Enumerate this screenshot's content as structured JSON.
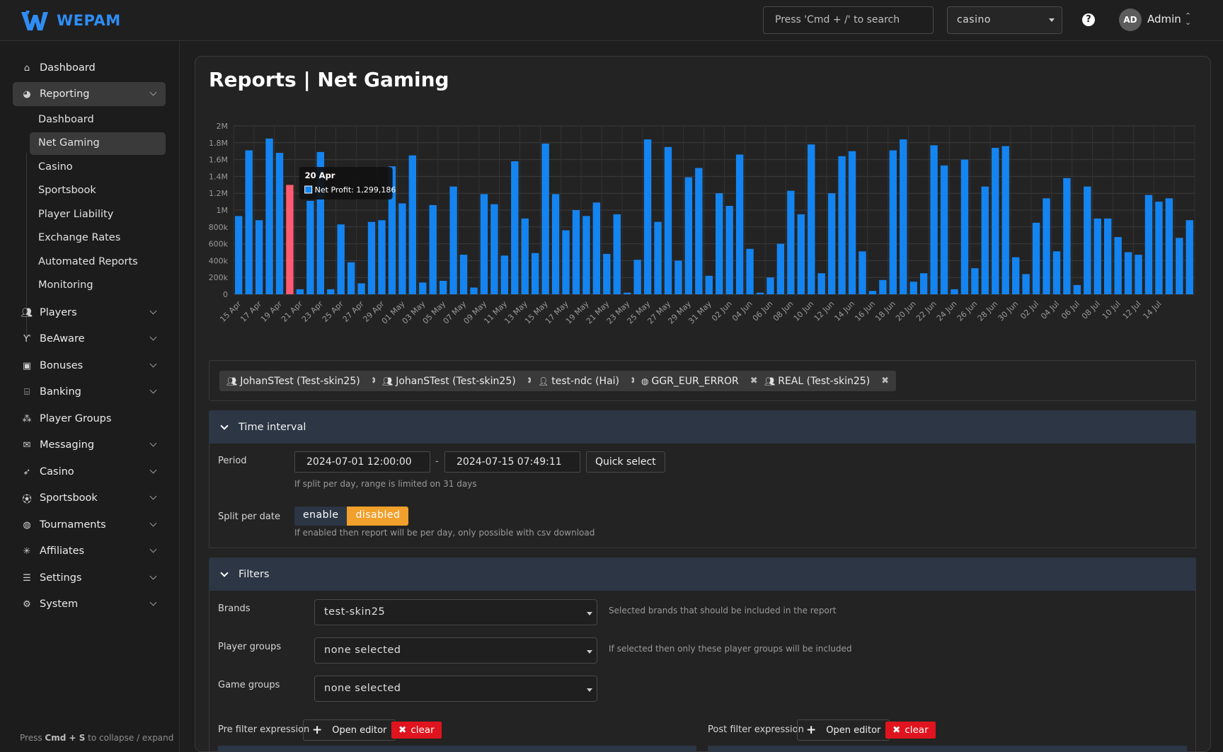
{
  "app": {
    "name": "WEPAM"
  },
  "topbar": {
    "search_placeholder": "Press 'Cmd + /' to search",
    "brand_selected": "casino",
    "help_label": "?",
    "avatar_initials": "AD",
    "user_name": "Admin"
  },
  "sidebar": {
    "items": [
      {
        "label": "Dashboard",
        "icon": "home-icon"
      },
      {
        "label": "Reporting",
        "icon": "pie-chart-icon"
      },
      {
        "label": "Players",
        "icon": "users-icon"
      },
      {
        "label": "BeAware",
        "icon": "branch-icon"
      },
      {
        "label": "Bonuses",
        "icon": "gift-card-icon"
      },
      {
        "label": "Banking",
        "icon": "bank-icon"
      },
      {
        "label": "Player Groups",
        "icon": "group-icon"
      },
      {
        "label": "Messaging",
        "icon": "envelope-icon"
      },
      {
        "label": "Casino",
        "icon": "rocket-icon"
      },
      {
        "label": "Sportsbook",
        "icon": "ball-icon"
      },
      {
        "label": "Tournaments",
        "icon": "trophy-icon"
      },
      {
        "label": "Affiliates",
        "icon": "network-icon"
      },
      {
        "label": "Settings",
        "icon": "sliders-icon"
      },
      {
        "label": "System",
        "icon": "cog-icon"
      }
    ],
    "reporting_sub": [
      "Dashboard",
      "Net Gaming",
      "Casino",
      "Sportsbook",
      "Player Liability",
      "Exchange Rates",
      "Automated Reports",
      "Monitoring"
    ],
    "collapse_hint_pre": "Press ",
    "collapse_hint_key": "Cmd + S",
    "collapse_hint_post": " to collapse / expand"
  },
  "page": {
    "title": "Reports | Net Gaming"
  },
  "chart_data": {
    "type": "bar",
    "series": [
      {
        "name": "Net Profit",
        "color": "#1484f0",
        "highlight_color": "#ff5b72"
      }
    ],
    "y_ticks": [
      "0",
      "200k",
      "400k",
      "600k",
      "800k",
      "1M",
      "1.2M",
      "1.4M",
      "1.6M",
      "1.8M",
      "2M"
    ],
    "ylim": [
      0,
      2000000
    ],
    "x_labels": [
      "15 Apr",
      "17 Apr",
      "19 Apr",
      "21 Apr",
      "23 Apr",
      "25 Apr",
      "27 Apr",
      "29 Apr",
      "01 May",
      "03 May",
      "05 May",
      "07 May",
      "09 May",
      "11 May",
      "13 May",
      "15 May",
      "17 May",
      "19 May",
      "21 May",
      "23 May",
      "25 May",
      "27 May",
      "29 May",
      "31 May",
      "02 Jun",
      "04 Jun",
      "06 Jun",
      "08 Jun",
      "10 Jun",
      "12 Jun",
      "14 Jun",
      "16 Jun",
      "18 Jun",
      "20 Jun",
      "22 Jun",
      "24 Jun",
      "26 Jun",
      "28 Jun",
      "30 Jun",
      "02 Jul",
      "04 Jul",
      "06 Jul",
      "08 Jul",
      "10 Jul",
      "12 Jul",
      "14 Jul"
    ],
    "values": [
      930000,
      1710000,
      880000,
      1850000,
      1680000,
      1299186,
      60000,
      1110000,
      1690000,
      60000,
      830000,
      380000,
      130000,
      860000,
      880000,
      1520000,
      1080000,
      1650000,
      140000,
      1060000,
      160000,
      1280000,
      470000,
      80000,
      1190000,
      1070000,
      460000,
      1580000,
      900000,
      490000,
      1790000,
      1190000,
      760000,
      1000000,
      930000,
      1090000,
      480000,
      950000,
      20000,
      410000,
      1840000,
      860000,
      1750000,
      400000,
      1390000,
      1500000,
      220000,
      1200000,
      1050000,
      1660000,
      540000,
      20000,
      200000,
      600000,
      1230000,
      950000,
      1780000,
      250000,
      1200000,
      1640000,
      1700000,
      510000,
      40000,
      170000,
      1710000,
      1840000,
      150000,
      250000,
      1770000,
      1530000,
      60000,
      1600000,
      310000,
      1280000,
      1740000,
      1760000,
      440000,
      240000,
      850000,
      1140000,
      510000,
      1380000,
      110000,
      1280000,
      900000,
      900000,
      680000,
      500000,
      470000,
      1180000,
      1100000,
      1140000,
      670000,
      880000
    ],
    "highlight_index": 5,
    "tooltip": {
      "title": "20 Apr",
      "label": "Net Profit: 1,299,186"
    }
  },
  "filter_tags": [
    {
      "icon": "users-icon",
      "label": "JohanSTest (Test-skin25)"
    },
    {
      "icon": "users-icon",
      "label": "JohanSTest (Test-skin25)"
    },
    {
      "icon": "user-icon",
      "label": "test-ndc (Hai)"
    },
    {
      "icon": "globe-icon",
      "label": "GGR_EUR_ERROR"
    },
    {
      "icon": "users-icon",
      "label": "REAL (Test-skin25)"
    }
  ],
  "time_interval": {
    "header": "Time interval",
    "period_label": "Period",
    "start": "2024-07-01 12:00:00",
    "separator": "-",
    "end": "2024-07-15 07:49:11",
    "quick_select": "Quick select",
    "period_hint": "If split per day, range is limited on 31 days",
    "split_label": "Split per date",
    "split_enable": "enable",
    "split_disabled": "disabled",
    "split_hint": "If enabled then report will be per day, only possible with csv download"
  },
  "filters": {
    "header": "Filters",
    "brands_label": "Brands",
    "brands_value": "test-skin25",
    "brands_hint": "Selected brands that should be included in the report",
    "player_groups_label": "Player groups",
    "player_groups_value": "none selected",
    "player_groups_hint": "If selected then only these player groups will be included",
    "game_groups_label": "Game groups",
    "game_groups_value": "none selected",
    "pre_label": "Pre filter expression",
    "post_label": "Post filter expression",
    "open_editor": "Open editor",
    "clear": "clear"
  }
}
